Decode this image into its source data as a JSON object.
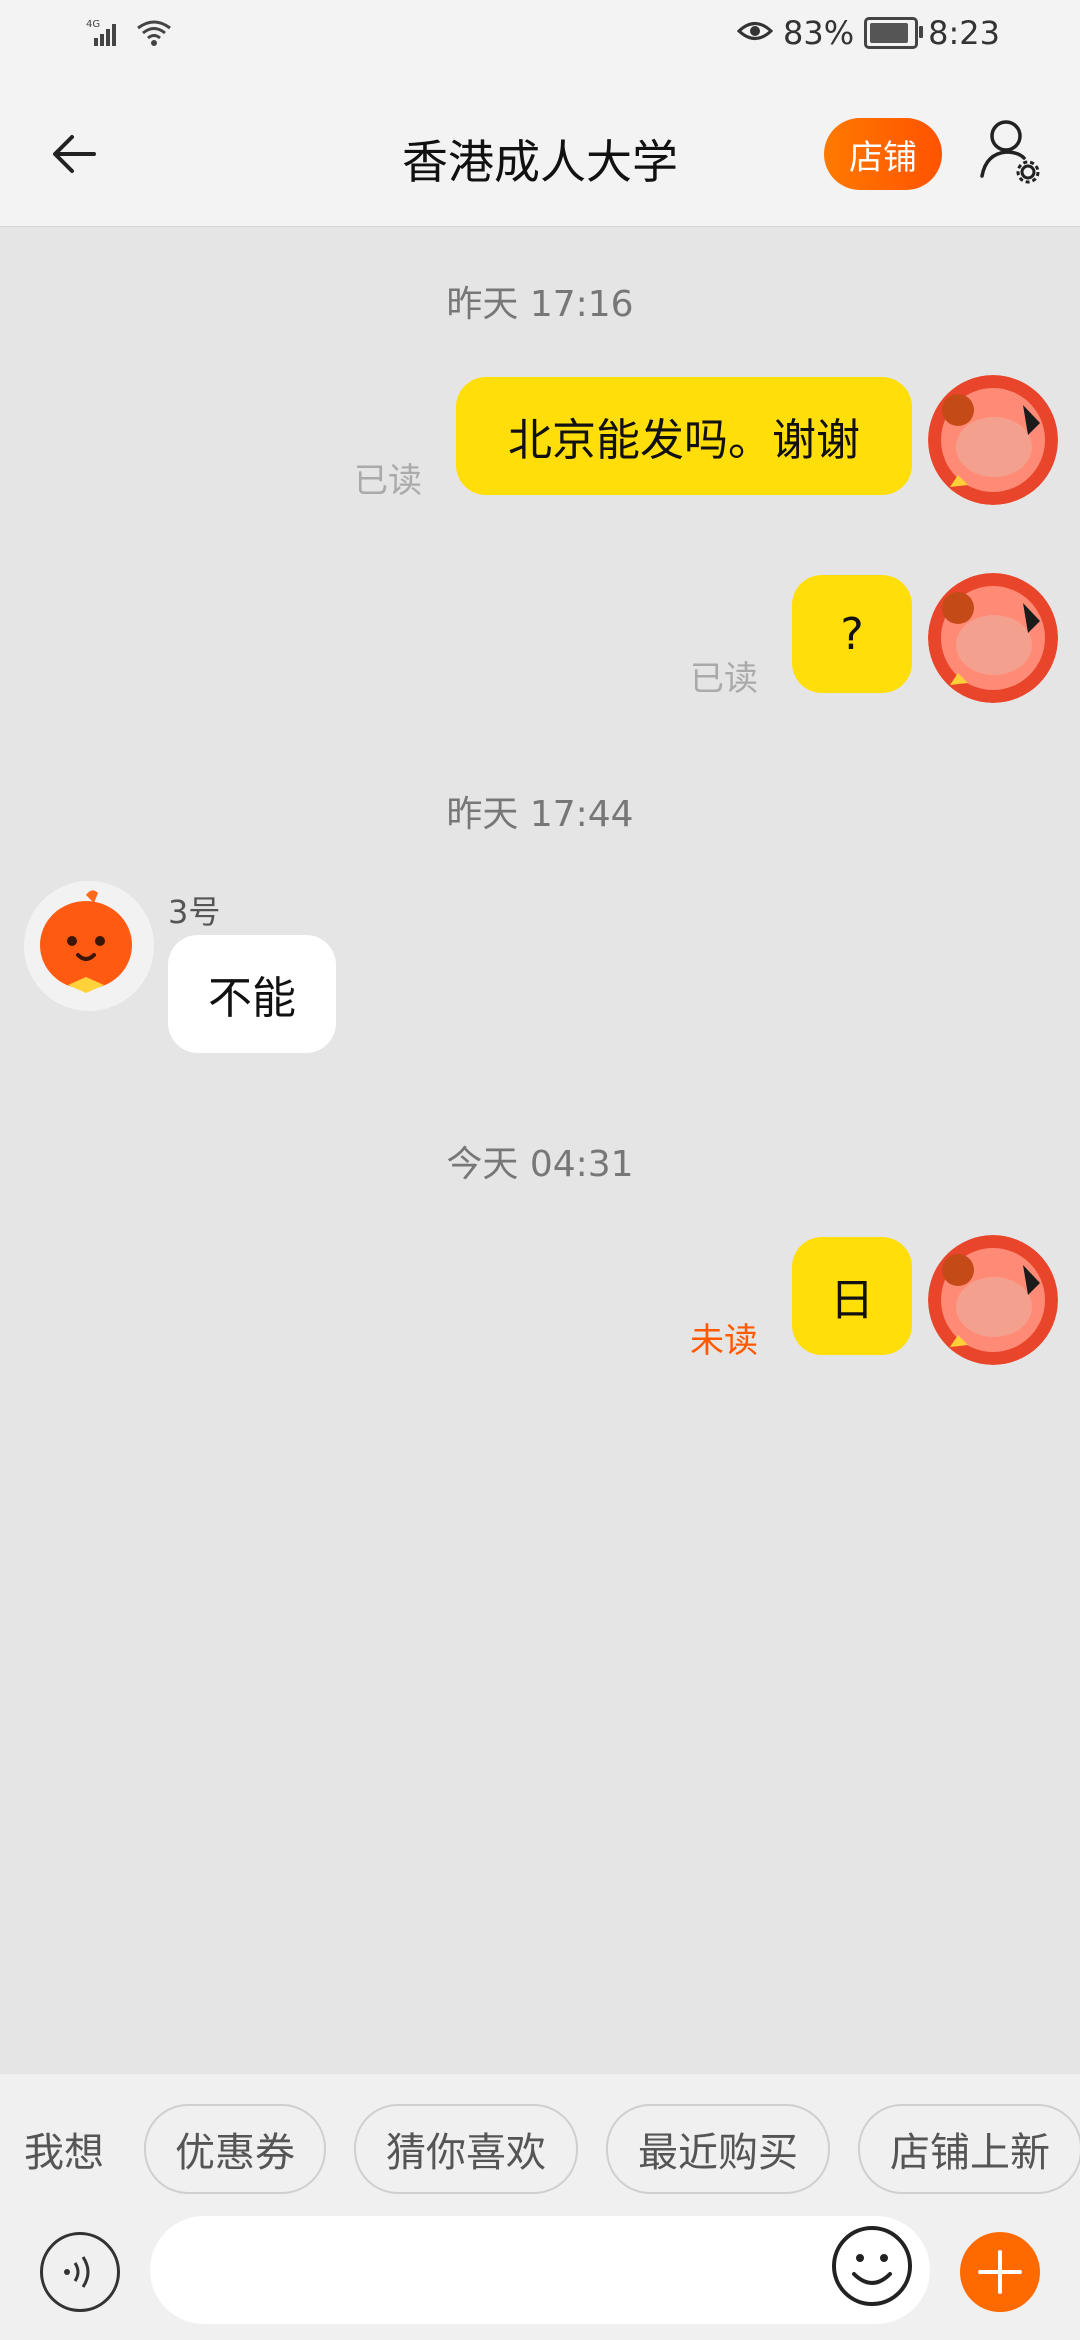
{
  "status_bar": {
    "network": "4G",
    "battery_percent": "83%",
    "time": "8:23",
    "icons": [
      "signal-icon",
      "wifi-icon",
      "eye-icon",
      "battery-icon"
    ]
  },
  "header": {
    "back_icon": "back-arrow-icon",
    "title": "香港成人大学",
    "shop_button": "店铺",
    "user_settings_icon": "user-settings-icon"
  },
  "messages": [
    {
      "type": "timestamp",
      "text": "昨天  17:16"
    },
    {
      "type": "sent",
      "text": "北京能发吗。谢谢",
      "status": "已读"
    },
    {
      "type": "sent",
      "text": "?",
      "status": "已读"
    },
    {
      "type": "timestamp",
      "text": "昨天  17:44"
    },
    {
      "type": "received",
      "sender": "3号",
      "text": "不能"
    },
    {
      "type": "timestamp",
      "text": "今天  04:31"
    },
    {
      "type": "sent",
      "text": "日",
      "status": "未读"
    }
  ],
  "quick_bar": {
    "label": "我想",
    "chips": [
      "优惠券",
      "猜你喜欢",
      "最近购买",
      "店铺上新"
    ]
  },
  "input_bar": {
    "voice_icon": "voice-icon",
    "text_value": "",
    "emoji_icon": "emoji-icon",
    "plus_icon": "plus-icon"
  },
  "colors": {
    "accent": "#ff6a00",
    "sent_bubble": "#ffde0a",
    "unread": "#ff5a00",
    "background": "#e5e5e5"
  }
}
